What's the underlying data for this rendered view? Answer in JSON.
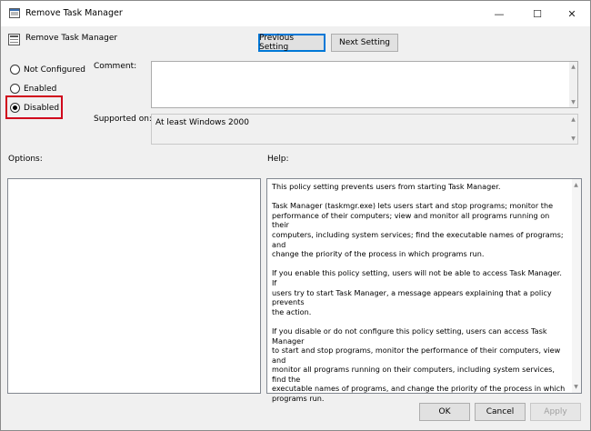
{
  "window": {
    "title": "Remove Task Manager",
    "minimize_glyph": "—",
    "maximize_glyph": "☐",
    "close_glyph": "✕"
  },
  "header": {
    "title": "Remove Task Manager",
    "prev_label": "Previous Setting",
    "next_label": "Next Setting"
  },
  "state": {
    "options": [
      {
        "label": "Not Configured",
        "checked": false
      },
      {
        "label": "Enabled",
        "checked": false
      },
      {
        "label": "Disabled",
        "checked": true
      }
    ]
  },
  "comment": {
    "label": "Comment:",
    "value": ""
  },
  "supported": {
    "label": "Supported on:",
    "value": "At least Windows 2000"
  },
  "options_label": "Options:",
  "help": {
    "label": "Help:",
    "paragraphs": [
      "This policy setting prevents users from starting Task Manager.",
      "Task Manager (taskmgr.exe) lets users start and stop programs; monitor the\nperformance of their computers; view and monitor all programs running on their\ncomputers, including system services; find the executable names of programs; and\nchange the priority of the process in which programs run.",
      "If you enable this policy setting, users will not be able to access Task Manager. If\nusers try to start Task Manager, a message appears explaining that a policy prevents\nthe action.",
      "If you disable or do not configure this policy setting, users can access Task Manager\nto  start and stop programs, monitor the performance of their computers, view and\nmonitor all programs running on their computers, including system services, find the\nexecutable names of programs, and change the priority of the process in which\nprograms run."
    ]
  },
  "footer": {
    "ok_label": "OK",
    "cancel_label": "Cancel",
    "apply_label": "Apply"
  },
  "colors": {
    "highlight": "#d0021b",
    "focus": "#0078d7"
  }
}
